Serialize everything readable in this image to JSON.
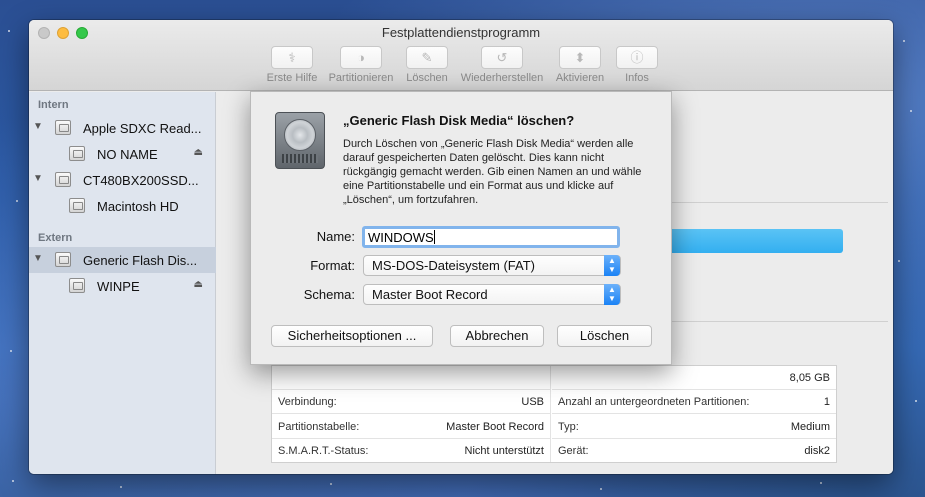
{
  "window": {
    "title": "Festplattendienstprogramm"
  },
  "toolbar": {
    "items": [
      {
        "label": "Erste Hilfe",
        "icon": "stethoscope-icon"
      },
      {
        "label": "Partitionieren",
        "icon": "pie-partition-icon"
      },
      {
        "label": "Löschen",
        "icon": "erase-icon"
      },
      {
        "label": "Wiederherstellen",
        "icon": "restore-icon"
      },
      {
        "label": "Aktivieren",
        "icon": "mount-icon"
      },
      {
        "label": "Infos",
        "icon": "info-icon"
      }
    ]
  },
  "sidebar": {
    "section_internal": "Intern",
    "section_external": "Extern",
    "items": [
      {
        "label": "Apple SDXC Read...",
        "type": "disk"
      },
      {
        "label": "NO NAME",
        "type": "volume"
      },
      {
        "label": "CT480BX200SSD...",
        "type": "disk"
      },
      {
        "label": "Macintosh HD",
        "type": "volume"
      },
      {
        "label": "Generic Flash Dis...",
        "type": "disk"
      },
      {
        "label": "WINPE",
        "type": "volume"
      }
    ]
  },
  "info_table": {
    "left": [
      {
        "key": "",
        "value": ""
      },
      {
        "key": "Verbindung:",
        "value": "USB"
      },
      {
        "key": "Partitionstabelle:",
        "value": "Master Boot Record"
      },
      {
        "key": "S.M.A.R.T.-Status:",
        "value": "Nicht unterstützt"
      }
    ],
    "right": [
      {
        "key": "",
        "value": "8,05 GB"
      },
      {
        "key": "Anzahl an untergeordneten Partitionen:",
        "value": "1"
      },
      {
        "key": "Typ:",
        "value": "Medium"
      },
      {
        "key": "Gerät:",
        "value": "disk2"
      }
    ]
  },
  "dialog": {
    "title": "„Generic Flash Disk Media“ löschen?",
    "message": "Durch Löschen von „Generic Flash Disk Media“ werden alle darauf gespeicherten Daten gelöscht. Dies kann nicht rückgängig gemacht werden. Gib einen Namen an und wähle eine Partitionstabelle und ein Format aus und klicke auf „Löschen“, um fortzufahren.",
    "name_label": "Name:",
    "name_value": "WINDOWS",
    "format_label": "Format:",
    "format_value": "MS-DOS-Dateisystem (FAT)",
    "scheme_label": "Schema:",
    "scheme_value": "Master Boot Record",
    "security_button": "Sicherheitsoptionen ...",
    "cancel_button": "Abbrechen",
    "erase_button": "Löschen"
  },
  "colors": {
    "accent": "#1a82f5",
    "usage_bar": "#33aff0",
    "sidebar_bg": "#dfe5ee",
    "sidebar_selected": "#c7d0dd"
  }
}
